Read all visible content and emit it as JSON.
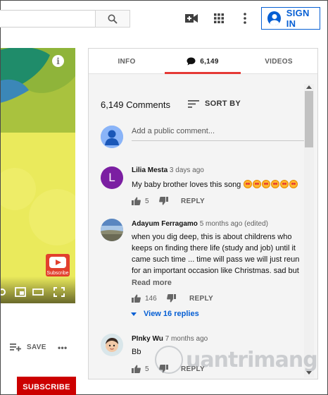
{
  "header": {
    "search_placeholder": "",
    "signin_label": "SIGN IN"
  },
  "video": {
    "info_label": "i",
    "subscribe_badge": "Subscribe"
  },
  "actions": {
    "save_label": "SAVE",
    "more_label": "•••"
  },
  "channel": {
    "subscribe_label": "SUBSCRIBE"
  },
  "tabs": [
    {
      "label": "INFO",
      "active": false
    },
    {
      "label": "6,149",
      "active": true
    },
    {
      "label": "VIDEOS",
      "active": false
    }
  ],
  "comments_header": {
    "count_label": "6,149 Comments",
    "sort_label": "SORT BY",
    "add_placeholder": "Add a public comment..."
  },
  "comments": [
    {
      "author": "Lilia Mesta",
      "time": "3 days ago",
      "avatar_letter": "L",
      "avatar_color": "#7b1fa2",
      "text": "My baby brother loves this song",
      "likes": "5",
      "reply_label": "REPLY"
    },
    {
      "author": "Adayum Ferragamo",
      "time": "5 months ago (edited)",
      "lines": [
        "when you dig deep, this is about childrens who",
        "keeps on finding  there life (study and job) until it",
        "came such time ... time will pass we will just reun",
        "for an important occasion like Christmas. sad but"
      ],
      "read_more": "Read more",
      "likes": "146",
      "reply_label": "REPLY",
      "view_replies": "View 16 replies"
    },
    {
      "author": "PInky Wu",
      "time": "7 months ago",
      "text": "Bb",
      "likes": "5",
      "reply_label": "REPLY"
    }
  ],
  "watermark": "uantrimang",
  "colors": {
    "accent_blue": "#065fd4",
    "active_tab_red": "#e53935",
    "subscribe_red": "#cc0000"
  }
}
